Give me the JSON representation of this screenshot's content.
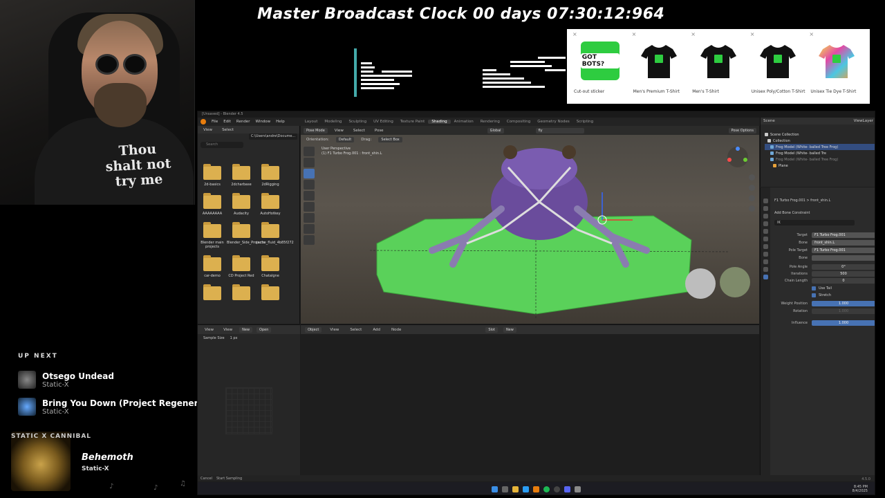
{
  "overlay": {
    "clock": "Master Broadcast Clock 00 days 07:30:12:964",
    "shirt_text": "Thou shalt not try me",
    "merch": [
      {
        "label": "Cut-out sticker",
        "kind": "sticker",
        "badge": "GOT BOTS?"
      },
      {
        "label": "Men's Premium T-Shirt",
        "kind": "tee-black"
      },
      {
        "label": "Men's T-Shirt",
        "kind": "tee-black"
      },
      {
        "label": "Unisex Poly/Cotton T-Shirt",
        "kind": "tee-black"
      },
      {
        "label": "Unisex Tie Dye T-Shirt",
        "kind": "tee-tiedye"
      }
    ],
    "up_next_title": "UP NEXT",
    "up_next": [
      {
        "title": "Otsego Undead",
        "artist": "Static-X"
      },
      {
        "title": "Bring You Down (Project Regeneration)",
        "artist": "Static-X"
      }
    ],
    "now_playing": {
      "band_logo": "STATIC X CANNIBAL",
      "title": "Behemoth",
      "artist": "Static-X"
    },
    "close_glyph": "×"
  },
  "blender": {
    "window_title": "[Unsaved] - Blender 4.5",
    "menus": [
      "File",
      "Edit",
      "Render",
      "Window",
      "Help"
    ],
    "workspaces": [
      "Layout",
      "Modeling",
      "Sculpting",
      "UV Editing",
      "Texture Paint",
      "Shading",
      "Animation",
      "Rendering",
      "Compositing",
      "Geometry Nodes",
      "Scripting"
    ],
    "active_workspace": "Shading",
    "file_browser": {
      "header": [
        "View",
        "Select"
      ],
      "path": "C:\\Users\\andre\\Docume...",
      "search_placeholder": "Search",
      "folders": [
        "2d-basics",
        "2dcharbase",
        "2dRigging",
        "AAAAAAAA",
        "Audacity",
        "AutoHotkey",
        "Blender main projects",
        "Blender_Side_Projects",
        "cache_fluid_4b85f272",
        "car-demo",
        "CD Project Red",
        "Chatalgne",
        "",
        "",
        ""
      ]
    },
    "viewport": {
      "mode": "Pose Mode",
      "header_menus": [
        "View",
        "Select",
        "Pose"
      ],
      "orientation_label": "Orientation:",
      "orientation": "Default",
      "drag_label": "Drag:",
      "drag": "Select Box",
      "transform": "Global",
      "search": "fly",
      "pose_options": "Pose Options",
      "info_line1": "User Perspective",
      "info_line2": "(1) F1 Turbo Frog.001 : front_shin.L"
    },
    "outliner": {
      "scene": "Scene",
      "view_layer": "ViewLayer",
      "search_placeholder": "",
      "rows": [
        {
          "text": "Scene Collection",
          "cls": ""
        },
        {
          "text": "Collection",
          "cls": ""
        },
        {
          "text": "Frog Model (White- balled Tree Frog)",
          "cls": "sel"
        },
        {
          "text": "Frog Model (White- balled Tre",
          "cls": ""
        },
        {
          "text": "Frog Model (White- balled Tree Frog)",
          "cls": "dim"
        },
        {
          "text": "Plane",
          "cls": ""
        }
      ]
    },
    "properties": {
      "breadcrumb": "F1 Turbo Frog.001  >  front_shin.L",
      "add_constraint": "Add Bone Constraint",
      "constraint_name": "IK",
      "rows": [
        {
          "label": "Target",
          "value": "F1 Turbo Frog.001",
          "kind": ""
        },
        {
          "label": "Bone",
          "value": "front_shin.L",
          "kind": ""
        },
        {
          "label": "Pole Target",
          "value": "F1 Turbo Frog.001",
          "kind": ""
        },
        {
          "label": "Bone",
          "value": "",
          "kind": ""
        },
        {
          "label": "Pole Angle",
          "value": "0°",
          "kind": "num"
        },
        {
          "label": "Iterations",
          "value": "500",
          "kind": "num"
        },
        {
          "label": "Chain Length",
          "value": "0",
          "kind": "num"
        },
        {
          "label": "",
          "value": "Use Tail",
          "kind": "check"
        },
        {
          "label": "",
          "value": "Stretch",
          "kind": "check"
        },
        {
          "label": "Weight Position",
          "value": "1.000",
          "kind": "blue"
        },
        {
          "label": "Rotation",
          "value": "1.000",
          "kind": "dis"
        },
        {
          "label": "Influence",
          "value": "1.000",
          "kind": "blue"
        }
      ]
    },
    "image_editor": {
      "header": [
        "View",
        "View"
      ],
      "buttons": [
        "New",
        "Open"
      ],
      "tool": "Sample Size",
      "tool_value": "1 px"
    },
    "shader_editor": {
      "header": [
        "Object",
        "View",
        "Select",
        "Add",
        "Node"
      ],
      "slot": "Slot",
      "new": "New"
    },
    "status": [
      "Cancel",
      "Start Sampling"
    ],
    "version": "4.5.0",
    "clock_time": "8:45 PM",
    "clock_date": "8/4/2025"
  }
}
